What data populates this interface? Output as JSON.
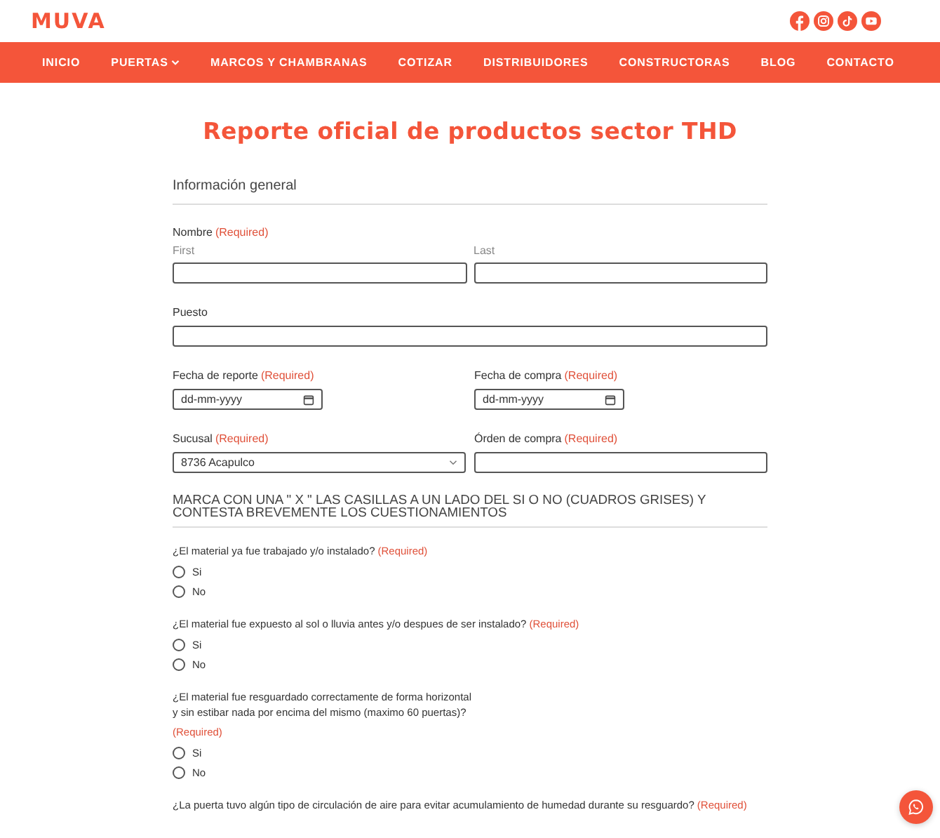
{
  "header": {
    "logo": "MUVA",
    "social": [
      {
        "kind": "facebook"
      },
      {
        "kind": "instagram"
      },
      {
        "kind": "tiktok"
      },
      {
        "kind": "youtube"
      }
    ]
  },
  "nav": [
    {
      "label": "INICIO",
      "dropdown": false
    },
    {
      "label": "PUERTAS",
      "dropdown": true
    },
    {
      "label": "MARCOS Y CHAMBRANAS",
      "dropdown": false
    },
    {
      "label": "COTIZAR",
      "dropdown": false
    },
    {
      "label": "DISTRIBUIDORES",
      "dropdown": false
    },
    {
      "label": "CONSTRUCTORAS",
      "dropdown": false
    },
    {
      "label": "BLOG",
      "dropdown": false
    },
    {
      "label": "CONTACTO",
      "dropdown": false
    }
  ],
  "title": "Reporte oficial de productos sector THD",
  "section1": {
    "heading": "Información general",
    "rows": [
      {
        "fields": [
          {
            "kind": "name",
            "label": "Nombre",
            "required": "(Required)",
            "sublabels": [
              "First",
              "Last"
            ]
          }
        ]
      },
      {
        "fields": [
          {
            "kind": "text",
            "label": "Puesto"
          }
        ]
      },
      {
        "fields": [
          {
            "kind": "date",
            "label": "Fecha de reporte",
            "required": "(Required)",
            "placeholder": "dd-mm-yyyy"
          },
          {
            "kind": "date",
            "label": "Fecha de compra",
            "required": "(Required)",
            "placeholder": "dd-mm-yyyy"
          }
        ]
      },
      {
        "fields": [
          {
            "kind": "select",
            "label": "Sucusal",
            "required": "(Required)",
            "value": "8736 Acapulco"
          },
          {
            "kind": "text",
            "label": "Órden de compra",
            "required": "(Required)"
          }
        ]
      }
    ]
  },
  "section2": {
    "heading": "MARCA CON UNA \" X \" LAS CASILLAS A UN LADO DEL SI O NO (CUADROS GRISES) Y CONTESTA BREVEMENTE LOS CUESTIONAMIENTOS",
    "questions": [
      {
        "text": "¿El material ya fue trabajado y/o instalado?",
        "required": "(Required)",
        "narrow": false,
        "options": [
          {
            "label": "Si",
            "selected": false
          },
          {
            "label": "No",
            "selected": false
          }
        ]
      },
      {
        "text": "¿El material fue expuesto al sol o lluvia antes y/o despues de ser instalado?",
        "required": "(Required)",
        "narrow": false,
        "options": [
          {
            "label": "Si",
            "selected": false
          },
          {
            "label": "No",
            "selected": false
          }
        ]
      },
      {
        "text": "¿El material fue resguardado correctamente de forma horizontal y sin estibar nada por encima del mismo (maximo 60 puertas)?",
        "required": "(Required)",
        "narrow": true,
        "options": [
          {
            "label": "Si",
            "selected": false
          },
          {
            "label": "No",
            "selected": false
          }
        ]
      },
      {
        "text": "¿La puerta tuvo algún tipo de circulación de aire para evitar acumulamiento de humedad durante su resguardo?",
        "required": "(Required)",
        "narrow": false
      }
    ]
  }
}
